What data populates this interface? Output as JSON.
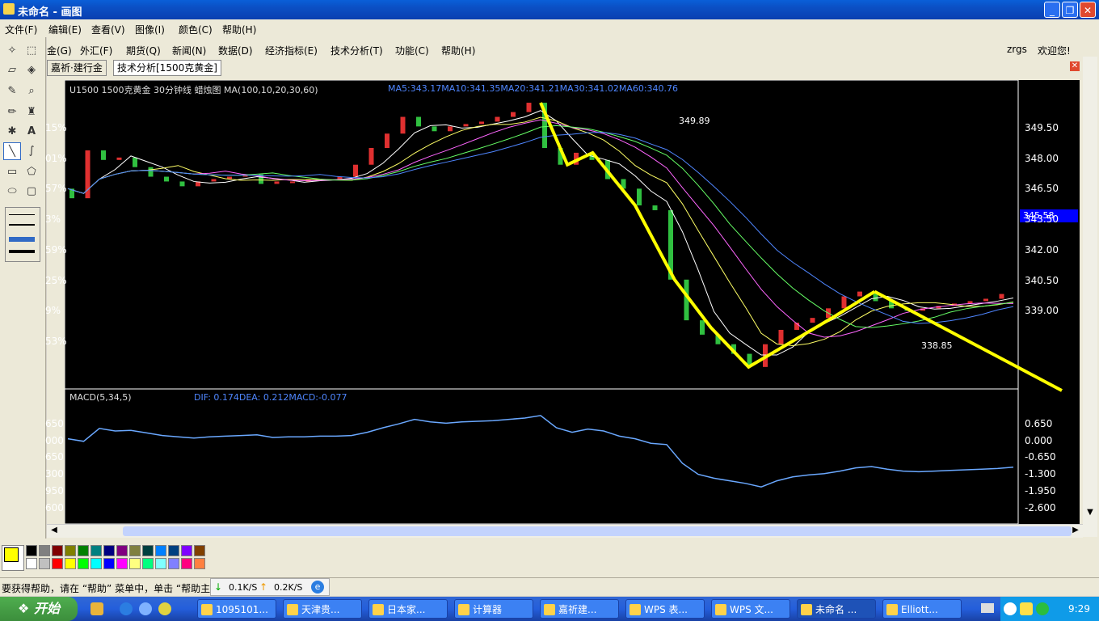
{
  "window": {
    "title": "未命名 - 画图"
  },
  "menubar": [
    "文件(F)",
    "编辑(E)",
    "查看(V)",
    "图像(I)",
    "颜色(C)",
    "帮助(H)"
  ],
  "app_menu": [
    "金(G)",
    "外汇(F)",
    "期货(Q)",
    "新闻(N)",
    "数据(D)",
    "经济指标(E)",
    "技术分析(T)",
    "功能(C)",
    "帮助(H)"
  ],
  "app_user": {
    "name": "zrgs",
    "greet": "欢迎您!"
  },
  "tabs": [
    "嘉祈·建行金",
    "技术分析[1500克黄金]"
  ],
  "chart": {
    "header": "U1500 1500克黄金 30分钟线 蜡烛图 MA(100,10,20,30,60)",
    "ma_text": "MA5:343.17MA10:341.35MA20:341.21MA30:341.02MA60:340.76",
    "macd_header": "MACD(5,34,5)",
    "macd_values": "DIF: 0.174DEA: 0.212MACD:-0.077",
    "price_high_label": "349.89",
    "price_low_label": "338.85",
    "current_price": "345.58",
    "left_axis": [
      "15%",
      "01%",
      "57%",
      "3%",
      "59%",
      "25%",
      "9%",
      "53%"
    ],
    "right_axis": [
      "349.50",
      "348.00",
      "346.50",
      "343.50",
      "342.00",
      "340.50",
      "339.00"
    ],
    "macd_right_axis": [
      "0.650",
      "0.000",
      "-0.650",
      "-1.300",
      "-1.950",
      "-2.600"
    ],
    "macd_left_axis": [
      "650",
      "000",
      "650",
      "300",
      "950",
      "600"
    ]
  },
  "chart_data": {
    "type": "line",
    "series": [
      {
        "x": [
          0,
          10,
          20,
          30,
          40,
          50,
          60,
          70,
          80,
          90,
          100,
          110,
          120,
          130,
          140,
          150,
          160,
          170,
          180,
          190,
          200,
          210,
          220,
          230,
          240,
          250,
          260,
          270,
          280,
          290,
          300,
          310,
          320,
          330,
          340,
          350,
          360,
          370,
          380,
          390,
          400,
          410,
          420,
          430,
          440,
          450,
          460,
          470,
          480,
          490,
          500,
          510,
          520,
          530,
          540,
          550,
          560,
          570,
          580,
          590,
          600
        ],
        "values": [
          346.3,
          345.9,
          347.9,
          347.5,
          347.6,
          347.2,
          346.8,
          346.6,
          346.4,
          346.6,
          346.7,
          346.8,
          346.9,
          346.5,
          346.6,
          346.6,
          346.7,
          346.7,
          346.8,
          347.3,
          348.0,
          348.6,
          349.3,
          348.9,
          348.7,
          348.9,
          349.0,
          349.1,
          349.3,
          349.5,
          349.89,
          348.0,
          347.3,
          347.8,
          347.5,
          346.7,
          346.3,
          345.6,
          345.4,
          342.5,
          340.8,
          340.2,
          339.8,
          339.4,
          338.85,
          339.8,
          340.4,
          340.7,
          340.9,
          341.3,
          341.8,
          342.0,
          341.6,
          341.3,
          341.2,
          341.3,
          341.4,
          341.5,
          341.6,
          341.7,
          341.9
        ]
      }
    ],
    "ylim": [
      338.0,
      350.5
    ]
  },
  "palette": [
    "#000000",
    "#808080",
    "#800000",
    "#808000",
    "#008000",
    "#008080",
    "#000080",
    "#800080",
    "#808040",
    "#004040",
    "#0080ff",
    "#004080",
    "#8000ff",
    "#804000",
    "#ffffff",
    "#c0c0c0",
    "#ff0000",
    "#ffff00",
    "#00ff00",
    "#00ffff",
    "#0000ff",
    "#ff00ff",
    "#ffff80",
    "#00ff80",
    "#80ffff",
    "#8080ff",
    "#ff0080",
    "#ff8040"
  ],
  "fg_color": "#ffff00",
  "status": {
    "help": "要获得帮助，请在 “帮助” 菜单中，单击 “帮助主题”",
    "down": "0.1K/S",
    "up": "0.2K/S"
  },
  "taskbar": {
    "start": "开始",
    "tasks": [
      "1095101...",
      "天津贵...",
      "日本家...",
      "计算器",
      "嘉祈建...",
      "WPS 表...",
      "WPS 文...",
      "未命名 ...",
      "Elliott..."
    ],
    "clock": "9:29"
  }
}
